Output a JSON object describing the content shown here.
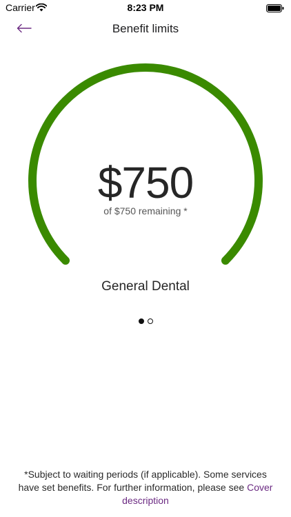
{
  "status_bar": {
    "carrier": "Carrier",
    "time": "8:23 PM",
    "icons": [
      "wifi-icon",
      "battery-icon"
    ]
  },
  "nav": {
    "title": "Benefit limits",
    "back_icon": "arrow-left-icon"
  },
  "gauge": {
    "amount": "$750",
    "remaining_text": "of $750 remaining *",
    "benefit_name": "General Dental",
    "remaining_fraction": 1.0,
    "track_color": "#3a8a00"
  },
  "pagination": {
    "current": 1,
    "total": 2
  },
  "footer": {
    "note_text": "*Subject to waiting periods (if applicable). Some services have set benefits. For further information, please see",
    "link_text": "Cover description",
    "link_color": "#6b2a82"
  },
  "colors": {
    "accent": "#6b2a82",
    "gauge_green": "#3a8a00"
  }
}
